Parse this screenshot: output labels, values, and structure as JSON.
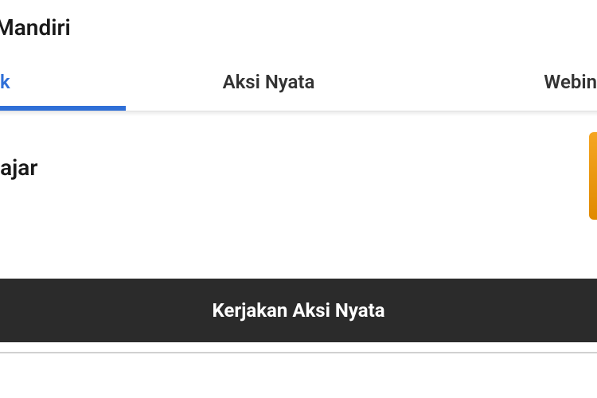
{
  "header": {
    "title_fragment": "han Mandiri"
  },
  "tabs": {
    "items": [
      {
        "label_fragment": "k",
        "active": true
      },
      {
        "label": "Aksi Nyata",
        "active": false
      },
      {
        "label_fragment": "Webin",
        "active": false
      }
    ]
  },
  "content": {
    "title_fragment": "Belajar"
  },
  "cta": {
    "label": "Kerjakan Aksi Nyata"
  }
}
